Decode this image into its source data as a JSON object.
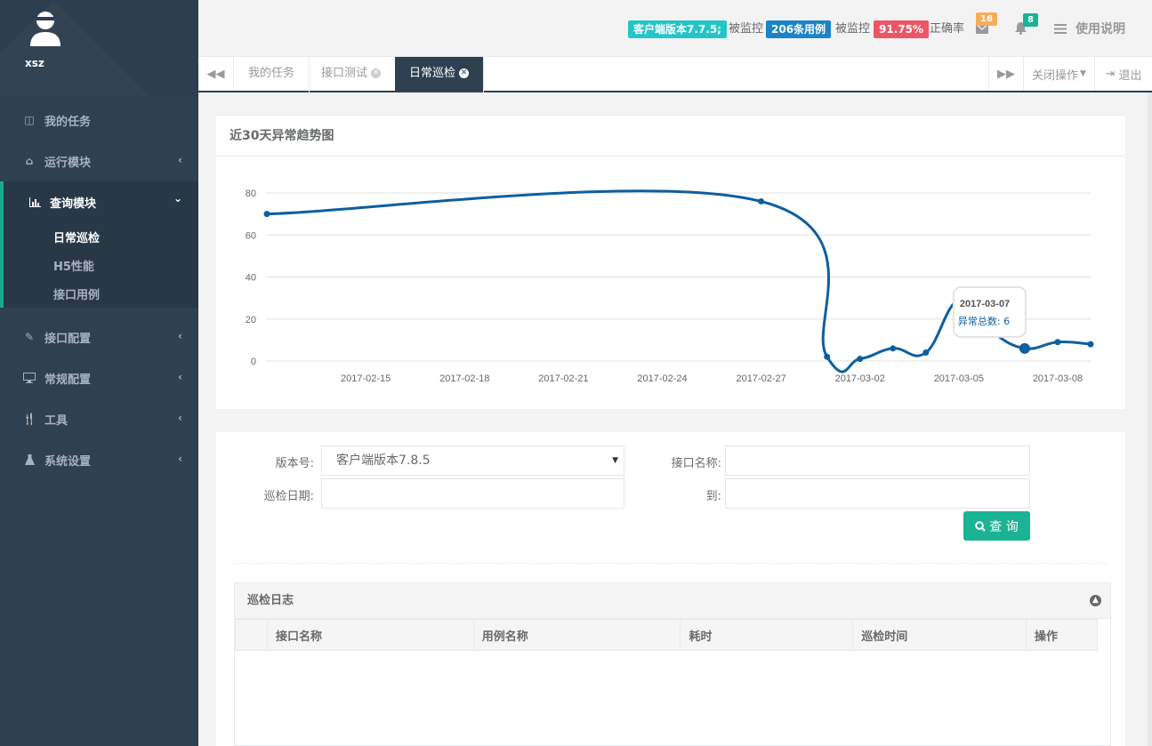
{
  "profile": {
    "username": "xsz"
  },
  "sidebar": {
    "items": [
      {
        "label": "我的任务",
        "icon": "columns-icon",
        "arrow": ""
      },
      {
        "label": "运行模块",
        "icon": "home-icon",
        "arrow": "‹"
      },
      {
        "label": "查询模块",
        "icon": "bar-chart-icon",
        "arrow": "⌄",
        "sub": [
          "日常巡检",
          "H5性能",
          "接口用例"
        ]
      },
      {
        "label": "接口配置",
        "icon": "edit-icon",
        "arrow": "‹"
      },
      {
        "label": "常规配置",
        "icon": "desktop-icon",
        "arrow": "‹"
      },
      {
        "label": "工具",
        "icon": "cutlery-icon",
        "arrow": "‹"
      },
      {
        "label": "系统设置",
        "icon": "flask-icon",
        "arrow": "‹"
      }
    ]
  },
  "topbar": {
    "client_version_label": "客户端版本7.7.5;",
    "monitored_1": "被监控",
    "cases_label": "206条用例",
    "monitored_2": "被监控",
    "accuracy_label": "91.75%",
    "accuracy_text": "正确率",
    "mail_count": "16",
    "bell_count": "8",
    "help_label": "使用说明",
    "colors": {
      "version": "#23c6c8",
      "cases": "#1c84c6",
      "accuracy": "#ed5565",
      "mail": "#f8ac59",
      "bell": "#1ab394"
    }
  },
  "tabs": {
    "items": [
      {
        "label": "我的任务",
        "closable": false
      },
      {
        "label": "接口测试",
        "closable": true
      },
      {
        "label": "日常巡检",
        "closable": true,
        "active": true
      }
    ],
    "close_ops": "关闭操作",
    "logout": "退出"
  },
  "chart_panel": {
    "title": "近30天异常趋势图"
  },
  "chart_data": {
    "type": "line",
    "x": [
      "2017-02-12",
      "2017-02-27",
      "2017-03-01",
      "2017-03-02",
      "2017-03-03",
      "2017-03-04",
      "2017-03-05",
      "2017-03-06",
      "2017-03-07",
      "2017-03-08",
      "2017-03-09"
    ],
    "values": [
      70,
      76,
      2,
      1,
      6,
      4,
      29,
      14,
      6,
      9,
      8
    ],
    "xticks": [
      "2017-02-15",
      "2017-02-18",
      "2017-02-21",
      "2017-02-24",
      "2017-02-27",
      "2017-03-02",
      "2017-03-05",
      "2017-03-08"
    ],
    "yticks": [
      0,
      20,
      40,
      60,
      80
    ],
    "ylim": [
      0,
      80
    ],
    "series_color": "#0e5f9e",
    "smooth": true,
    "grid": true,
    "tooltip": {
      "date": "2017-03-07",
      "label": "异常总数",
      "value": "6"
    }
  },
  "form": {
    "version_label": "版本号:",
    "version_value": "客户端版本7.8.5",
    "api_name_label": "接口名称:",
    "date_label": "巡检日期:",
    "to_label": "到:",
    "query_label": "查 询"
  },
  "log": {
    "title": "巡检日志",
    "columns": [
      "接口名称",
      "用例名称",
      "耗时",
      "巡检时间",
      "操作"
    ]
  }
}
